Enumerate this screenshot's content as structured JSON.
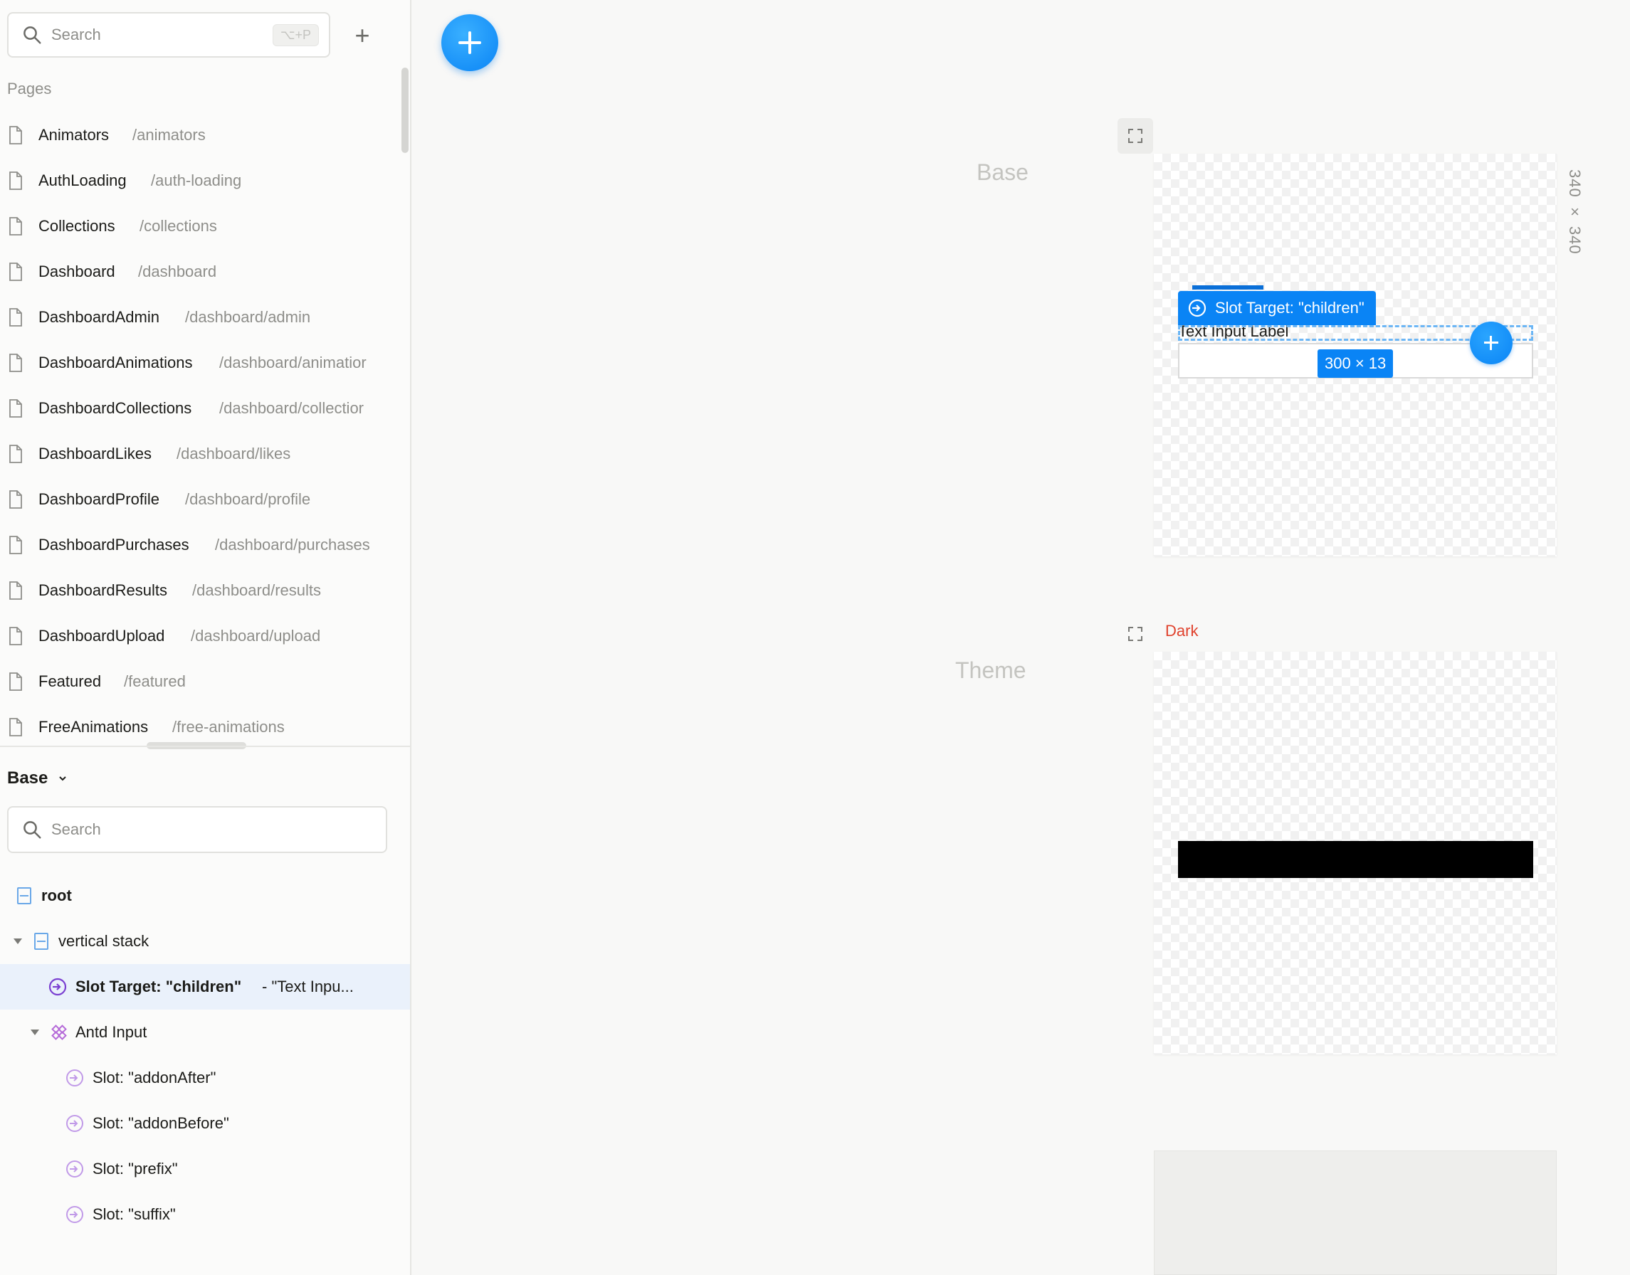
{
  "left_panel": {
    "search_placeholder": "Search",
    "search_shortcut": "⌥+P",
    "add_label": "+",
    "pages_label": "Pages",
    "pages": [
      {
        "name": "Animators",
        "path": "/animators"
      },
      {
        "name": "AuthLoading",
        "path": "/auth-loading"
      },
      {
        "name": "Collections",
        "path": "/collections"
      },
      {
        "name": "Dashboard",
        "path": "/dashboard"
      },
      {
        "name": "DashboardAdmin",
        "path": "/dashboard/admin"
      },
      {
        "name": "DashboardAnimations",
        "path": "/dashboard/animatior"
      },
      {
        "name": "DashboardCollections",
        "path": "/dashboard/collectior"
      },
      {
        "name": "DashboardLikes",
        "path": "/dashboard/likes"
      },
      {
        "name": "DashboardProfile",
        "path": "/dashboard/profile"
      },
      {
        "name": "DashboardPurchases",
        "path": "/dashboard/purchases"
      },
      {
        "name": "DashboardResults",
        "path": "/dashboard/results"
      },
      {
        "name": "DashboardUpload",
        "path": "/dashboard/upload"
      },
      {
        "name": "Featured",
        "path": "/featured"
      },
      {
        "name": "FreeAnimations",
        "path": "/free-animations"
      }
    ],
    "variant_selector": "Base",
    "tree_search_placeholder": "Search",
    "tree": {
      "root": "root",
      "vertical_stack": "vertical stack",
      "slot_target": "Slot Target: \"children\"",
      "slot_target_suffix": "- \"Text Inpu...",
      "antd_input": "Antd Input",
      "slots": [
        "Slot: \"addonAfter\"",
        "Slot: \"addonBefore\"",
        "Slot: \"prefix\"",
        "Slot: \"suffix\""
      ]
    }
  },
  "canvas": {
    "base_label": "Base",
    "theme_label": "Theme",
    "dark_label": "Dark",
    "frame_size": "340 × 340",
    "slot_badge": "Slot Target: \"children\"",
    "input_label": "Text Input Label",
    "dimension_badge": "300 × 13"
  },
  "colors": {
    "accent": "#0a84f5",
    "dark_variant": "#e0422d",
    "selection_bg": "#eaf1fb"
  }
}
